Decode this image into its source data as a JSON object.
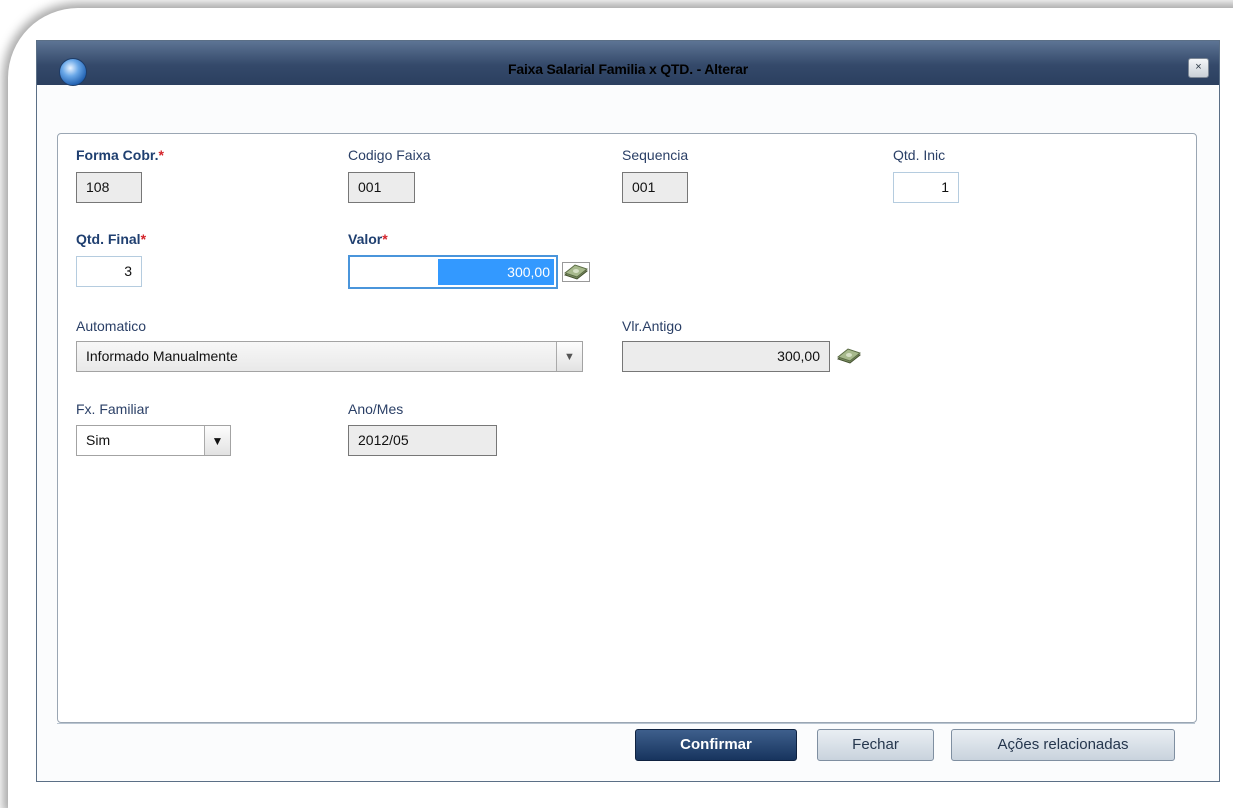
{
  "window": {
    "title": "Faixa Salarial Familia x QTD. - Alterar",
    "close_label": "×"
  },
  "fields": {
    "forma_cobr": {
      "label": "Forma Cobr.",
      "required_mark": "*",
      "value": "108"
    },
    "codigo_faixa": {
      "label": "Codigo Faixa",
      "value": "001"
    },
    "sequencia": {
      "label": "Sequencia",
      "value": "001"
    },
    "qtd_inic": {
      "label": "Qtd. Inic",
      "value": "1"
    },
    "qtd_final": {
      "label": "Qtd. Final",
      "required_mark": "*",
      "value": "3"
    },
    "valor": {
      "label": "Valor",
      "required_mark": "*",
      "value": "300,00"
    },
    "automatico": {
      "label": "Automatico",
      "value": "Informado Manualmente"
    },
    "vlr_antigo": {
      "label": "Vlr.Antigo",
      "value": "300,00"
    },
    "fx_familiar": {
      "label": "Fx. Familiar",
      "value": "Sim"
    },
    "ano_mes": {
      "label": "Ano/Mes",
      "value": "2012/05"
    }
  },
  "buttons": {
    "confirmar": "Confirmar",
    "fechar": "Fechar",
    "acoes": "Ações relacionadas"
  },
  "icons": {
    "money": "money-bills-icon",
    "dropdown": "chevron-down-icon",
    "app": "app-orb-icon"
  },
  "colors": {
    "titlebar": "#34496a",
    "label": "#2a3f66",
    "required": "#d4242b",
    "selection": "#3399ff"
  }
}
